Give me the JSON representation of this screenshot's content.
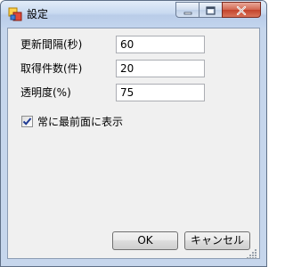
{
  "window": {
    "title": "設定",
    "icons": {
      "app": "app-window-icon",
      "minimize": "minimize-icon",
      "maximize": "maximize-icon",
      "close": "close-icon"
    }
  },
  "form": {
    "fields": [
      {
        "label": "更新間隔(秒)",
        "value": "60"
      },
      {
        "label": "取得件数(件)",
        "value": "20"
      },
      {
        "label": "透明度(%)",
        "value": "75"
      }
    ],
    "topmost_checkbox": {
      "label": "常に最前面に表示",
      "checked": true
    }
  },
  "buttons": {
    "ok_label": "OK",
    "cancel_label": "キャンセル"
  },
  "colors": {
    "title_bar": "#c9daf0",
    "client_background": "#f0f0f0",
    "close_button": "#c3432b",
    "checkmark": "#1f3a93"
  }
}
